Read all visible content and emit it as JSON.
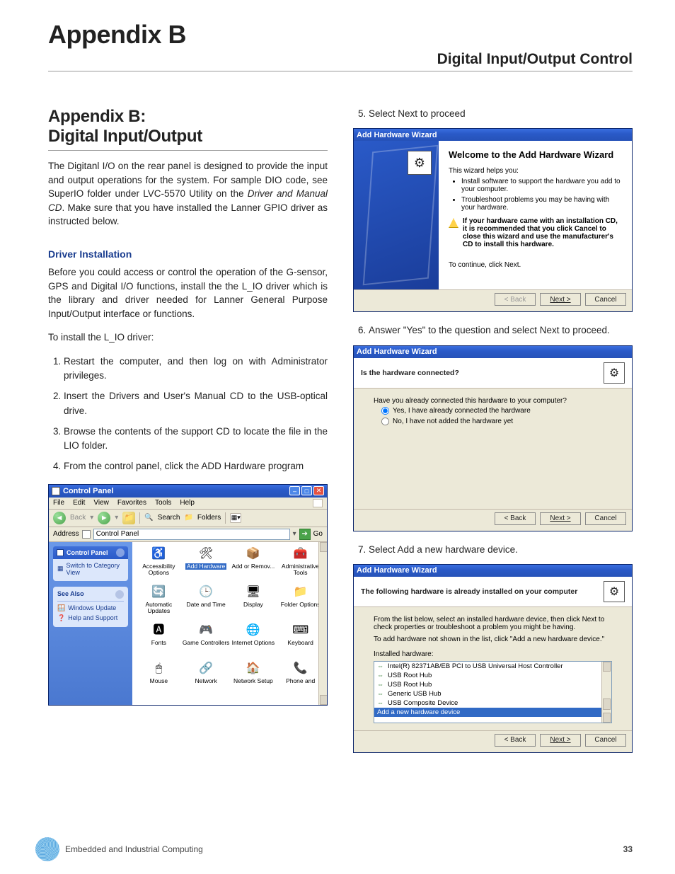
{
  "page": {
    "appendix_title": "Appendix B",
    "header_right": "Digital Input/Output Control",
    "section_title_1": "Appendix B:",
    "section_title_2": "Digital Input/Output",
    "intro_1": "The Digitanl I/O on the rear panel is designed to provide the input and output operations for the system. For sample DIO code, see SuperIO folder under LVC-5570 Utility on the ",
    "intro_em": "Driver and Manual CD",
    "intro_2": ". Make sure that you have installed the Lanner GPIO driver as instructed below.",
    "sub_heading": "Driver Installation",
    "p2": "Before you could access or control the operation of the G-sensor, GPS and Digital I/O functions, install the the L_IO driver which is the library and driver needed for Lanner General Purpose Input/Output interface or functions.",
    "p3": "To install the L_IO driver:",
    "steps": [
      "Restart the computer, and then log on with Administrator privileges.",
      "Insert the Drivers and User's Manual CD to the USB-optical drive.",
      "Browse the contents of the support CD to locate the file in the LIO folder.",
      "From the control panel, click the ADD Hardware program"
    ],
    "right_steps": {
      "s5": "Select Next to proceed",
      "s6": "Answer \"Yes\" to the question and select Next to proceed.",
      "s7": "Select Add a new hardware device."
    },
    "footer_text": "Embedded and Industrial Computing",
    "page_number": "33"
  },
  "control_panel": {
    "title": "Control Panel",
    "menu": [
      "File",
      "Edit",
      "View",
      "Favorites",
      "Tools",
      "Help"
    ],
    "back": "Back",
    "search": "Search",
    "folders": "Folders",
    "address_label": "Address",
    "address_value": "Control Panel",
    "go": "Go",
    "side_header": "Control Panel",
    "switch_view": "Switch to Category View",
    "see_also": "See Also",
    "windows_update": "Windows Update",
    "help_support": "Help and Support",
    "items": [
      {
        "l": "Accessibility Options",
        "g": "♿"
      },
      {
        "l": "Add Hardware",
        "g": "🛠",
        "sel": true
      },
      {
        "l": "Add or Remov...",
        "g": "📦"
      },
      {
        "l": "Administrative Tools",
        "g": "🧰"
      },
      {
        "l": "Automatic Updates",
        "g": "🔄"
      },
      {
        "l": "Date and Time",
        "g": "🕒"
      },
      {
        "l": "Display",
        "g": "🖥"
      },
      {
        "l": "Folder Options",
        "g": "📁"
      },
      {
        "l": "Fonts",
        "g": "🅰"
      },
      {
        "l": "Game Controllers",
        "g": "🎮"
      },
      {
        "l": "Internet Options",
        "g": "🌐"
      },
      {
        "l": "Keyboard",
        "g": "⌨"
      },
      {
        "l": "Mouse",
        "g": "🖱"
      },
      {
        "l": "Network",
        "g": "🔗"
      },
      {
        "l": "Network Setup",
        "g": "🏠"
      },
      {
        "l": "Phone and",
        "g": "📞"
      }
    ]
  },
  "wizard1": {
    "title": "Add Hardware Wizard",
    "heading": "Welcome to the Add Hardware Wizard",
    "helps": "This wizard helps you:",
    "b1": "Install software to support the hardware you add to your computer.",
    "b2": "Troubleshoot problems you may be having with your hardware.",
    "warn": "If your hardware came with an installation CD, it is recommended that you click Cancel to close this wizard and use the manufacturer's CD to install this hardware.",
    "cont": "To continue, click Next.",
    "back": "< Back",
    "next": "Next >",
    "cancel": "Cancel"
  },
  "wizard2": {
    "title": "Add Hardware Wizard",
    "heading": "Is the hardware connected?",
    "q": "Have you already connected this hardware to your computer?",
    "r1": "Yes, I have already connected the hardware",
    "r2": "No, I have not added the hardware yet",
    "back": "< Back",
    "next": "Next >",
    "cancel": "Cancel"
  },
  "wizard3": {
    "title": "Add Hardware Wizard",
    "heading": "The following hardware is already installed on your computer",
    "p1": "From the list below, select an installed hardware device, then click Next to check properties or troubleshoot a problem you might be having.",
    "p2": "To add hardware not shown in the list, click \"Add a new hardware device.\"",
    "list_label": "Installed hardware:",
    "rows": [
      "Intel(R) 82371AB/EB PCI to USB Universal Host Controller",
      "USB Root Hub",
      "USB Root Hub",
      "Generic USB Hub",
      "USB Composite Device",
      "Add a new hardware device"
    ],
    "back": "< Back",
    "next": "Next >",
    "cancel": "Cancel"
  }
}
